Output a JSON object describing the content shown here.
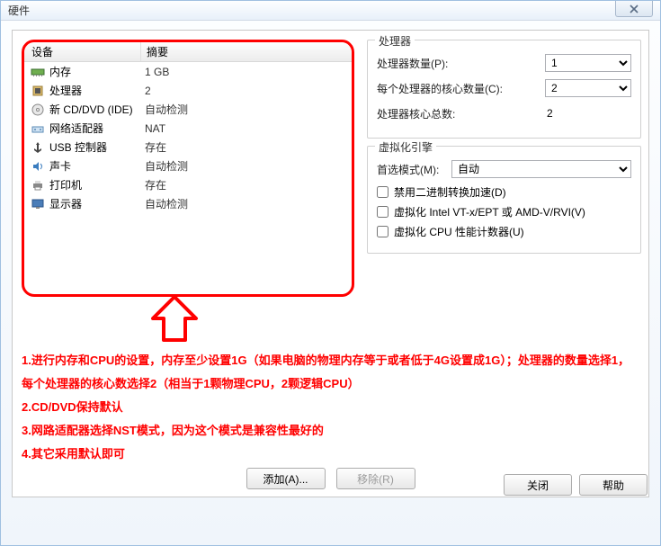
{
  "window": {
    "title": "硬件"
  },
  "device_table": {
    "col_device": "设备",
    "col_summary": "摘要",
    "rows": [
      {
        "icon": "memory-icon",
        "name": "内存",
        "summary": "1 GB"
      },
      {
        "icon": "cpu-icon",
        "name": "处理器",
        "summary": "2"
      },
      {
        "icon": "cd-icon",
        "name": "新 CD/DVD (IDE)",
        "summary": "自动检测"
      },
      {
        "icon": "network-icon",
        "name": "网络适配器",
        "summary": "NAT"
      },
      {
        "icon": "usb-icon",
        "name": "USB 控制器",
        "summary": "存在"
      },
      {
        "icon": "sound-icon",
        "name": "声卡",
        "summary": "自动检测"
      },
      {
        "icon": "printer-icon",
        "name": "打印机",
        "summary": "存在"
      },
      {
        "icon": "display-icon",
        "name": "显示器",
        "summary": "自动检测"
      }
    ]
  },
  "processor_group": {
    "title": "处理器",
    "num_processors_label": "处理器数量(P):",
    "num_processors_value": "1",
    "cores_per_label": "每个处理器的核心数量(C):",
    "cores_per_value": "2",
    "total_cores_label": "处理器核心总数:",
    "total_cores_value": "2"
  },
  "virt_group": {
    "title": "虚拟化引擎",
    "preferred_mode_label": "首选模式(M):",
    "preferred_mode_value": "自动",
    "chk_binary": "禁用二进制转换加速(D)",
    "chk_vtx": "虚拟化 Intel VT-x/EPT 或 AMD-V/RVI(V)",
    "chk_perf": "虚拟化 CPU 性能计数器(U)"
  },
  "instructions": {
    "line1": "1.进行内存和CPU的设置，内存至少设置1G（如果电脑的物理内存等于或者低于4G设置成1G）；处理器的数量选择1，每个处理器的核心数选择2（相当于1颗物理CPU，2颗逻辑CPU）",
    "line2": "2.CD/DVD保持默认",
    "line3": "3.网路适配器选择NST模式，因为这个模式是兼容性最好的",
    "line4": "4.其它采用默认即可"
  },
  "buttons": {
    "add": "添加(A)...",
    "remove": "移除(R)",
    "close": "关闭",
    "help": "帮助"
  }
}
